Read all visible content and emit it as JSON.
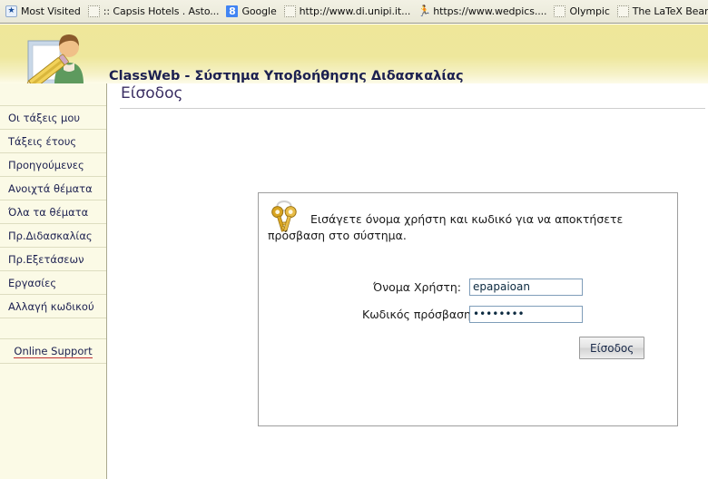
{
  "browser": {
    "bookmarks": [
      {
        "label": "Most Visited",
        "icon": "star-icon"
      },
      {
        "label": ":: Capsis Hotels . Asto...",
        "icon": "blank-page-icon"
      },
      {
        "label": "Google",
        "icon": "google-icon"
      },
      {
        "label": "http://www.di.unipi.it...",
        "icon": "blank-page-icon"
      },
      {
        "label": "https://www.wedpics....",
        "icon": "runner-icon"
      },
      {
        "label": "Olympic",
        "icon": "blank-page-icon"
      },
      {
        "label": "The LaTeX Beamer Cla...",
        "icon": "blank-page-icon"
      }
    ]
  },
  "header": {
    "logo_icon": "teacher-document-pencil-icon",
    "app_title": "ClassWeb - Σύστημα Υποβοήθησης Διδασκαλίας"
  },
  "sidebar": {
    "items": [
      {
        "label": "Οι τάξεις μου"
      },
      {
        "label": "Τάξεις έτους"
      },
      {
        "label": "Προηγούμενες"
      },
      {
        "label": "Ανοιχτά θέματα"
      },
      {
        "label": "Όλα τα θέματα"
      },
      {
        "label": "Πρ.Διδασκαλίας"
      },
      {
        "label": "Πρ.Εξετάσεων"
      },
      {
        "label": "Εργασίες"
      },
      {
        "label": "Αλλαγή κωδικού"
      }
    ],
    "support_link": "Online Support"
  },
  "main": {
    "page_title": "Είσοδος",
    "login_panel": {
      "key_icon": "two-keys-icon",
      "instruction": "Εισάγετε όνομα χρήστη και κωδικό για να αποκτήσετε πρόσβαση στο σύστημα.",
      "username_label": "Όνομα Χρήστη:",
      "username_value": "epapaioan",
      "username_placeholder": "",
      "password_label": "Κωδικός πρόσβασης:",
      "password_value": "••••••••",
      "password_placeholder": "",
      "submit_label": "Είσοδος"
    }
  },
  "colors": {
    "header_band": "#efe79a",
    "sidebar_bg": "#fbfae6",
    "title_text": "#3b2f63",
    "link_underline": "#c03030"
  }
}
